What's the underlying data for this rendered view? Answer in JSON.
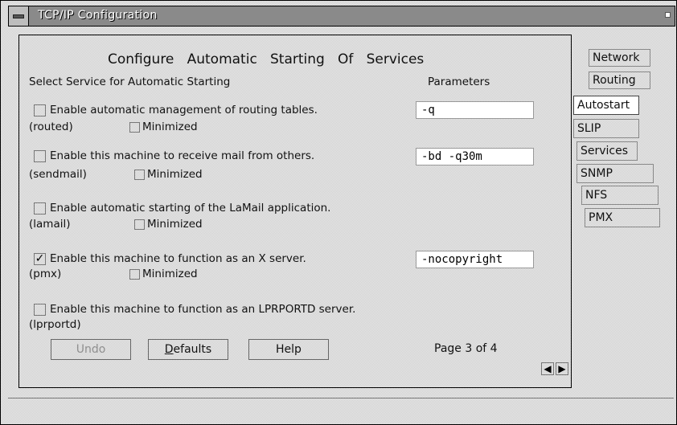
{
  "window": {
    "title": "TCP/IP Configuration"
  },
  "page": {
    "heading": "Configure   Automatic   Starting   Of   Services",
    "select_label": "Select Service for Automatic Starting",
    "params_label": "Parameters"
  },
  "services": [
    {
      "label": "Enable automatic management of routing tables.",
      "name": "(routed)",
      "checked": false,
      "checkmark": "",
      "minimized_label": "Minimized",
      "has_minimized": true,
      "has_param": true,
      "param": "-q"
    },
    {
      "label": "Enable this machine to receive mail from others.",
      "name": "(sendmail)",
      "checked": false,
      "checkmark": "",
      "minimized_label": "Minimized",
      "has_minimized": true,
      "has_param": true,
      "param": "-bd -q30m"
    },
    {
      "label": "Enable automatic starting of the LaMail application.",
      "name": "(lamail)",
      "checked": false,
      "checkmark": "",
      "minimized_label": "Minimized",
      "has_minimized": true,
      "has_param": false,
      "param": ""
    },
    {
      "label": "Enable this machine to function as an X server.",
      "name": "(pmx)",
      "checked": true,
      "checkmark": "✓",
      "minimized_label": "Minimized",
      "has_minimized": true,
      "has_param": true,
      "param": "-nocopyright"
    },
    {
      "label": "Enable this machine to function as an LPRPORTD server.",
      "name": "(lprportd)",
      "checked": false,
      "checkmark": "",
      "minimized_label": "",
      "has_minimized": false,
      "has_param": false,
      "param": ""
    }
  ],
  "buttons": {
    "undo": {
      "label": "Undo",
      "enabled": false
    },
    "defaults": {
      "label": "Defaults",
      "mnemonic": "D",
      "rest": "efaults"
    },
    "help": {
      "label": "Help"
    }
  },
  "page_indicator": "Page 3 of 4",
  "nav": {
    "prev_icon": "arrow-left-icon",
    "next_icon": "arrow-right-icon",
    "prev_glyph": "◀",
    "next_glyph": "▶"
  },
  "tabs": {
    "network": "Network",
    "routing": "Routing",
    "autostart": "Autostart",
    "slip": "SLIP",
    "services": "Services",
    "snmp": "SNMP",
    "nfs": "NFS",
    "pmx": "PMX"
  },
  "colors": {
    "titlebar": "#8a8a8a",
    "dither_base": "#cfcfcf",
    "field_bg": "#ffffff"
  }
}
